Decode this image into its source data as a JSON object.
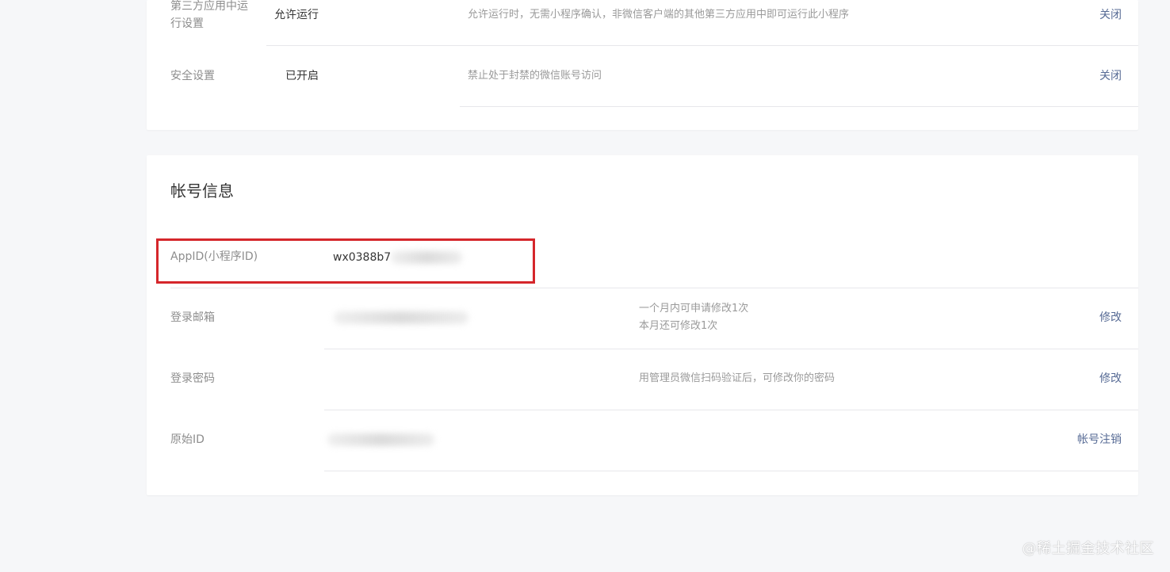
{
  "top_settings": {
    "rows": [
      {
        "label": "第三方应用中运行设置",
        "label_line1": "第三方应用中运",
        "label_line2": "行设置",
        "value": "允许运行",
        "description": "允许运行时，无需小程序确认，非微信客户端的其他第三方应用中即可运行此小程序",
        "action": "关闭"
      },
      {
        "label": "安全设置",
        "value": "已开启",
        "description": "禁止处于封禁的微信账号访问",
        "action": "关闭"
      }
    ]
  },
  "account_info": {
    "title": "帐号信息",
    "rows": [
      {
        "label": "AppID(小程序ID)",
        "value": "wx0388b7"
      },
      {
        "label": "登录邮箱",
        "description_line1": "一个月内可申请修改1次",
        "description_line2": "本月还可修改1次",
        "action": "修改"
      },
      {
        "label": "登录密码",
        "description": "用管理员微信扫码验证后，可修改你的密码",
        "action": "修改"
      },
      {
        "label": "原始ID",
        "action": "帐号注销"
      }
    ]
  },
  "watermark": "@稀土掘金技术社区",
  "colors": {
    "background": "#f6f7f9",
    "card": "#ffffff",
    "link": "#576b95",
    "highlight_border": "#d5262b",
    "divider": "#e7e7eb"
  }
}
